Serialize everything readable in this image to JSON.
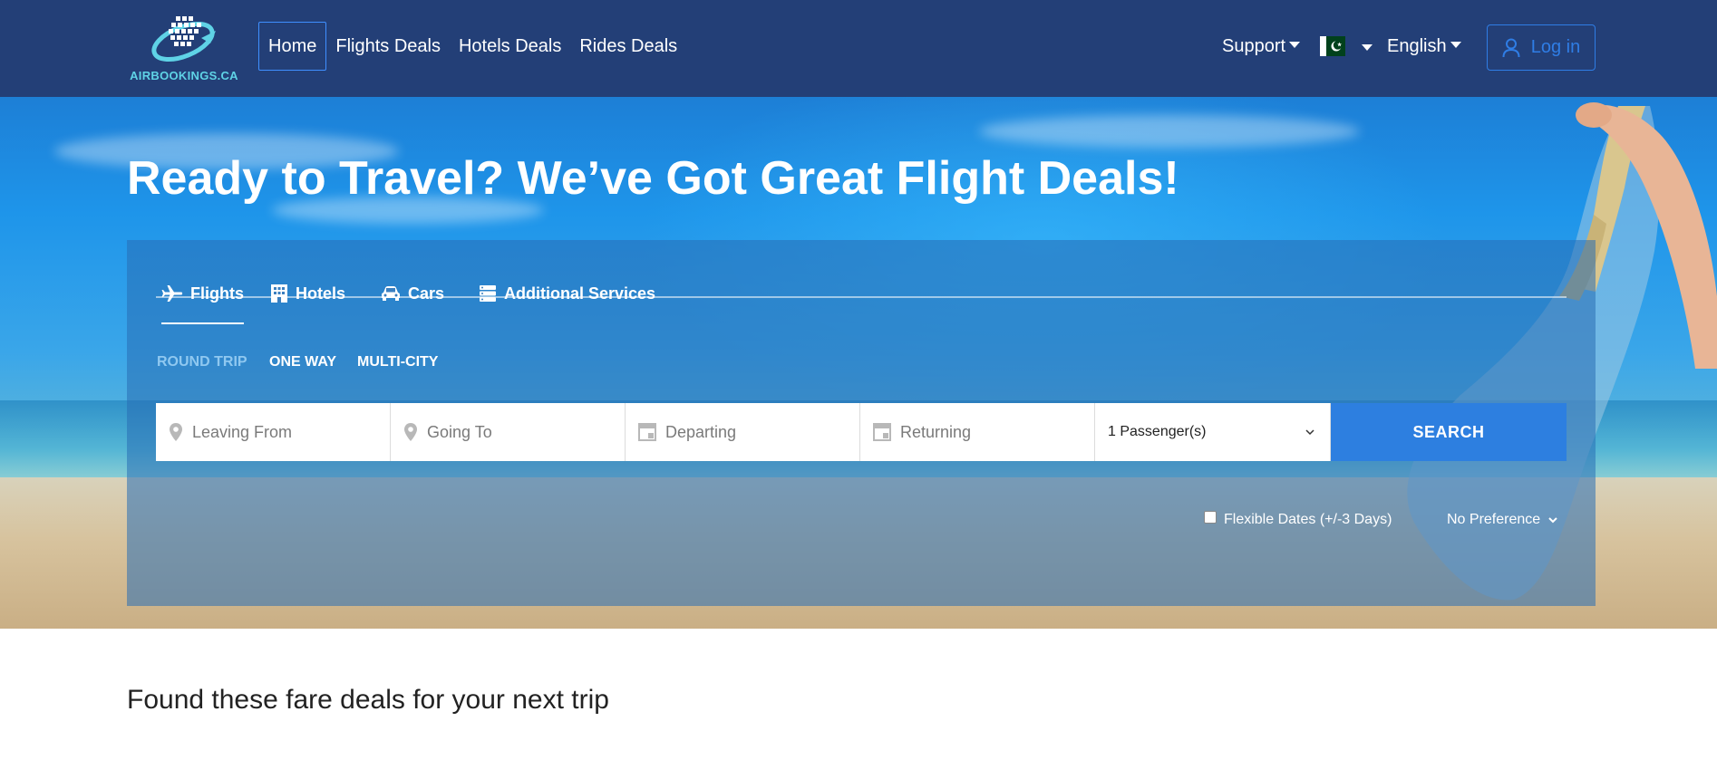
{
  "brand": {
    "name": "AIRBOOKINGS.CA"
  },
  "nav": {
    "links": [
      "Home",
      "Flights Deals",
      "Hotels Deals",
      "Rides Deals"
    ],
    "support": "Support",
    "language": "English",
    "login": "Log in"
  },
  "hero": {
    "title": "Ready to Travel? We’ve Got Great Flight Deals!"
  },
  "search": {
    "tabs": [
      "Flights",
      "Hotels",
      "Cars",
      "Additional Services"
    ],
    "active_tab": "Flights",
    "trip_types": [
      "ROUND TRIP",
      "ONE WAY",
      "MULTI-CITY"
    ],
    "active_trip_type": "ROUND TRIP",
    "leaving_placeholder": "Leaving From",
    "going_placeholder": "Going To",
    "departing_placeholder": "Departing",
    "returning_placeholder": "Returning",
    "passengers": "1 Passenger(s)",
    "search_button": "SEARCH",
    "flexible_dates": "Flexible Dates (+/-3 Days)",
    "preference": "No Preference"
  },
  "deals": {
    "title": "Found these fare deals for your next trip"
  },
  "colors": {
    "navbar": "#233f77",
    "accent": "#2d7fe0",
    "active_trip": "#8fc8f0"
  }
}
